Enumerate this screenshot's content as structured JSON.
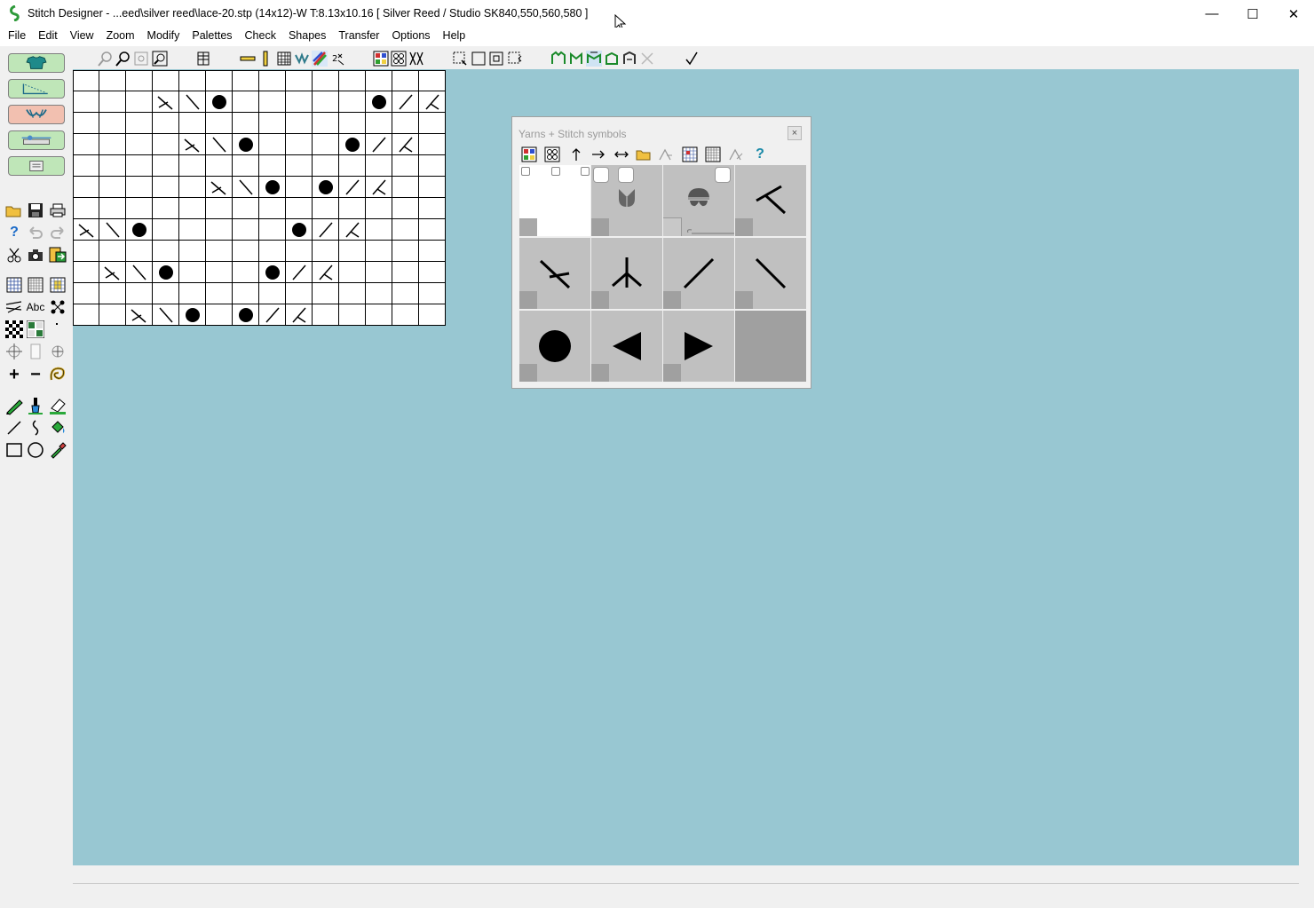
{
  "window": {
    "title": "Stitch Designer - ...eed\\silver reed\\lace-20.stp (14x12)-W     T:8.13x10.16     [ Silver Reed / Studio SK840,550,560,580 ]",
    "minimize": "—",
    "maximize": "☐",
    "close": "✕"
  },
  "menu": [
    "File",
    "Edit",
    "View",
    "Zoom",
    "Modify",
    "Palettes",
    "Check",
    "Shapes",
    "Transfer",
    "Options",
    "Help"
  ],
  "palette": {
    "title": "Yarns + Stitch symbols",
    "close": "×"
  },
  "grid": {
    "cols": 14,
    "rows": 12,
    "symbols": [
      [
        1,
        3,
        "k2tog"
      ],
      [
        1,
        4,
        "ssk"
      ],
      [
        1,
        5,
        "yo"
      ],
      [
        1,
        11,
        "yo"
      ],
      [
        1,
        12,
        "fwd"
      ],
      [
        1,
        13,
        "k2togR"
      ],
      [
        3,
        4,
        "k2tog"
      ],
      [
        3,
        5,
        "ssk"
      ],
      [
        3,
        6,
        "yo"
      ],
      [
        3,
        10,
        "yo"
      ],
      [
        3,
        11,
        "fwd"
      ],
      [
        3,
        12,
        "k2togR"
      ],
      [
        5,
        5,
        "k2tog"
      ],
      [
        5,
        6,
        "ssk"
      ],
      [
        5,
        7,
        "yo"
      ],
      [
        5,
        9,
        "yo"
      ],
      [
        5,
        10,
        "fwd"
      ],
      [
        5,
        11,
        "k2togR"
      ],
      [
        7,
        0,
        "k2tog"
      ],
      [
        7,
        1,
        "ssk"
      ],
      [
        7,
        2,
        "yo"
      ],
      [
        7,
        8,
        "yo"
      ],
      [
        7,
        9,
        "fwd"
      ],
      [
        7,
        10,
        "k2togR"
      ],
      [
        9,
        1,
        "k2tog"
      ],
      [
        9,
        2,
        "ssk"
      ],
      [
        9,
        3,
        "yo"
      ],
      [
        9,
        7,
        "yo"
      ],
      [
        9,
        8,
        "fwd"
      ],
      [
        9,
        9,
        "k2togR"
      ],
      [
        11,
        2,
        "k2tog"
      ],
      [
        11,
        3,
        "ssk"
      ],
      [
        11,
        4,
        "yo"
      ],
      [
        11,
        6,
        "yo"
      ],
      [
        11,
        7,
        "fwd"
      ],
      [
        11,
        8,
        "k2togR"
      ]
    ]
  },
  "colors": {
    "workspace": "#98c7d2",
    "swatch": "#c0c0c0",
    "swatch_corner": "#a0a0a0"
  }
}
